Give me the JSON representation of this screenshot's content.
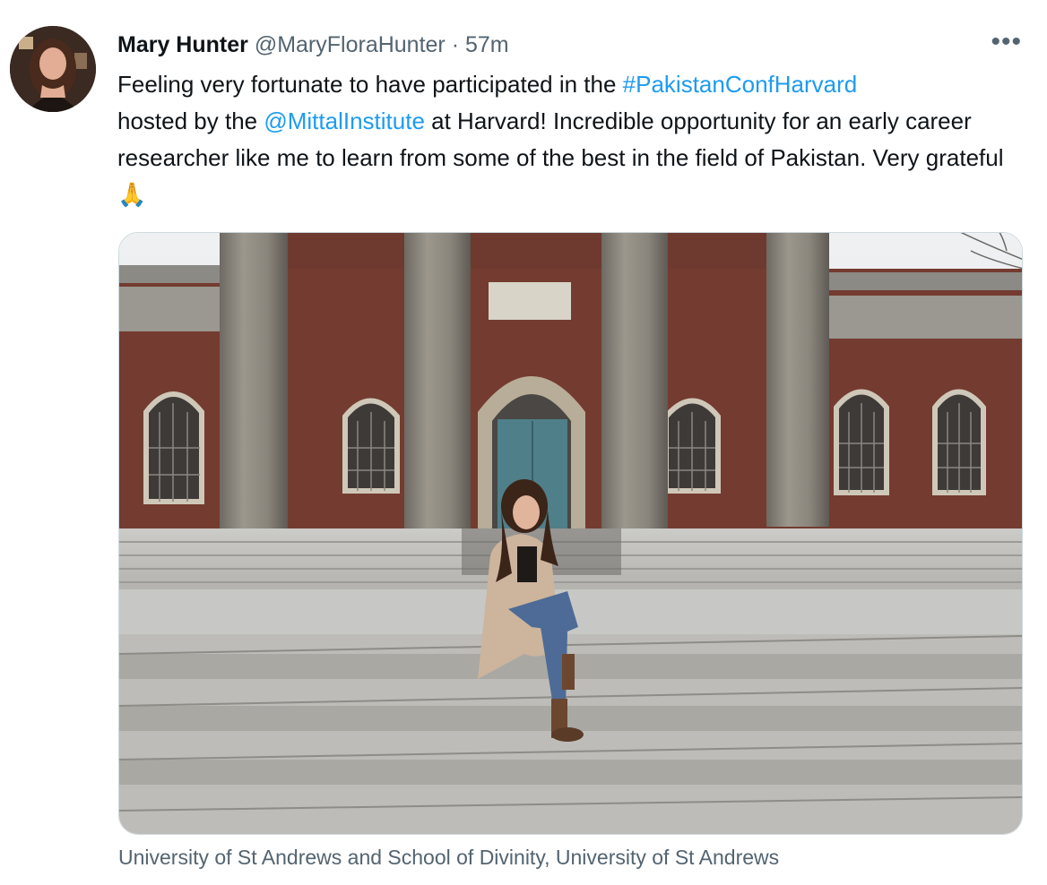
{
  "tweet": {
    "author_name": "Mary Hunter",
    "author_handle": "@MaryFloraHunter",
    "separator": "·",
    "timestamp": "57m",
    "more_icon": "more-horizontal-icon",
    "text_before_hashtag": "Feeling very fortunate to have participated in the ",
    "hashtag": "#PakistanConfHarvard",
    "text_before_mention": " hosted by the ",
    "mention": "@MittalInstitute",
    "text_after_mention": " at Harvard! Incredible opportunity for an early career researcher like me to learn from some of the best in the field of Pakistan. Very grateful ",
    "emoji": "🙏",
    "media_caption": "University of St Andrews and School of Divinity, University of St Andrews"
  },
  "colors": {
    "link": "#1d9bf0",
    "secondary_text": "#536471",
    "primary_text": "#0f1419"
  }
}
